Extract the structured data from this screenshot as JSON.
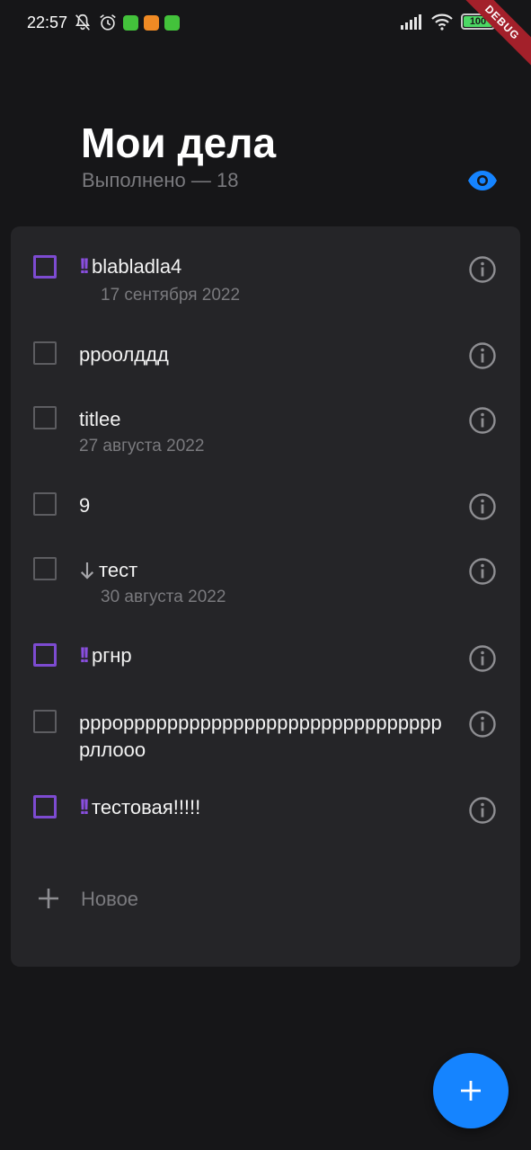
{
  "status_bar": {
    "time": "22:57",
    "battery": "100",
    "icons": [
      "bell-off-icon",
      "alarm-icon",
      "app-notification-icon",
      "app-notification-icon",
      "app-notification-icon",
      "signal-icon",
      "wifi-icon",
      "battery-icon"
    ],
    "debug_label": "DEBUG"
  },
  "header": {
    "title": "Мои дела",
    "subtitle": "Выполнено — 18",
    "visibility_icon": "eye-icon"
  },
  "tasks": [
    {
      "text": "blabladla4",
      "date": "17 сентября 2022",
      "priority": "high",
      "checked": false
    },
    {
      "text": "ррoолддд",
      "date": "",
      "priority": "none",
      "checked": false
    },
    {
      "text": "titlee",
      "date": "27 августа 2022",
      "priority": "none",
      "checked": false
    },
    {
      "text": "9",
      "date": "",
      "priority": "none",
      "checked": false
    },
    {
      "text": "тест",
      "date": "30 августа 2022",
      "priority": "low",
      "checked": false
    },
    {
      "text": "ргнр",
      "date": "",
      "priority": "high",
      "checked": false
    },
    {
      "text": "ррроррррррррррррррррррррррррррррррллооо",
      "date": "",
      "priority": "none",
      "checked": false
    },
    {
      "text": "тестовая!!!!!",
      "date": "",
      "priority": "high",
      "checked": false
    }
  ],
  "new_task": {
    "label": "Новое",
    "icon": "plus-icon"
  },
  "fab": {
    "icon": "plus-icon"
  },
  "colors": {
    "background": "#161618",
    "card": "#252528",
    "accent": "#1584ff",
    "priority": "#8a4fe0",
    "secondary_text": "#7a7a7e"
  }
}
